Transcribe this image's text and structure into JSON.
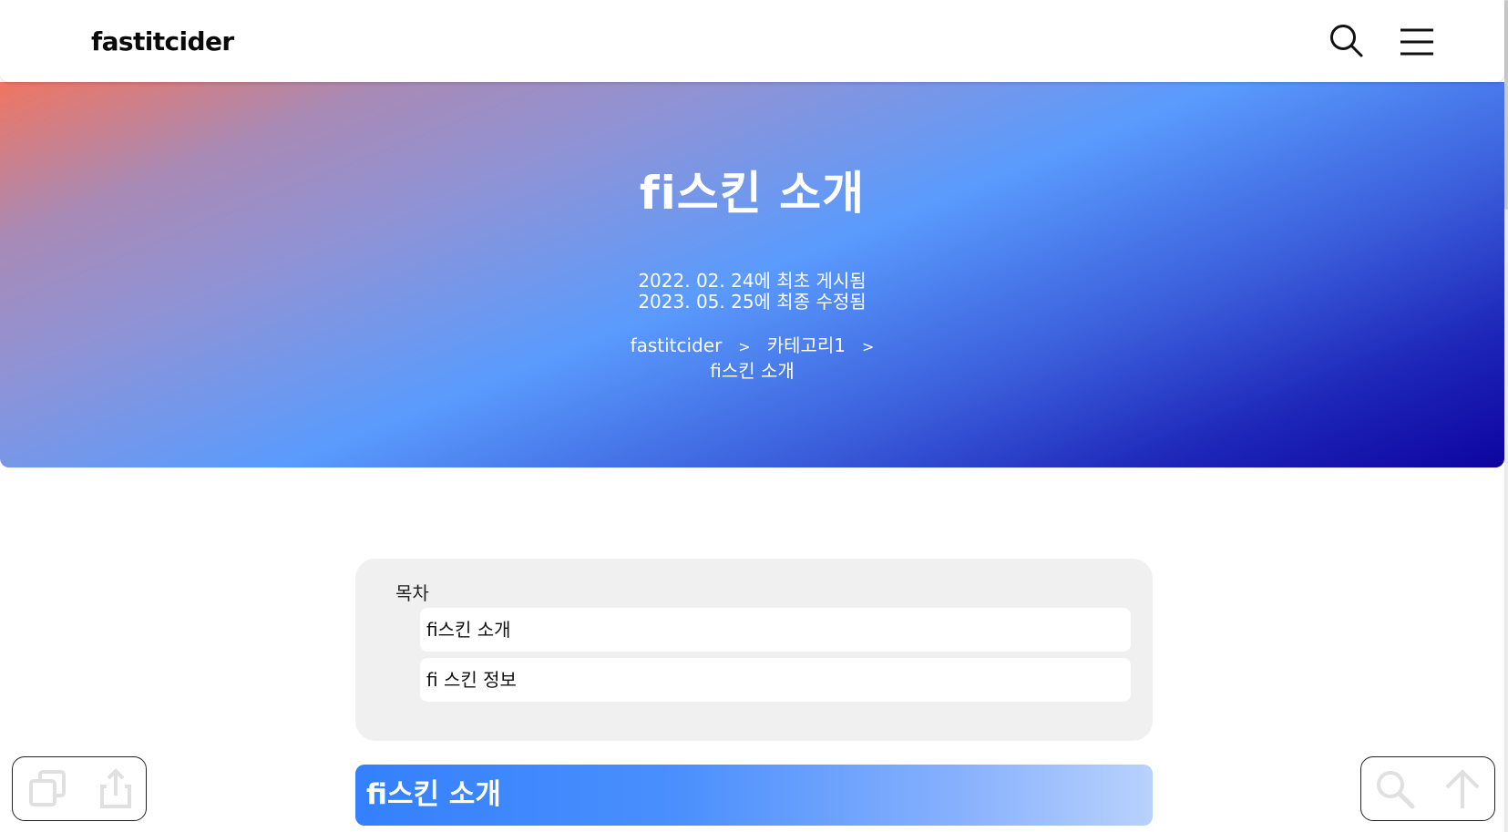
{
  "header": {
    "logo": "fastitcider",
    "search_icon": "search-icon",
    "menu_icon": "hamburger-menu-icon"
  },
  "hero": {
    "title": "fi스킨 소개",
    "posted": "2022. 02. 24에 최초 게시됨",
    "modified": "2023. 05. 25에 최종 수정됨",
    "breadcrumb": {
      "home": "fastitcider",
      "separator": ">",
      "category": "카테고리1",
      "current": "fi스킨 소개"
    },
    "gradient_colors": [
      "#f07560",
      "#5a9bfd",
      "#0e04a0"
    ]
  },
  "toc": {
    "title": "목차",
    "items": [
      {
        "label": "fi스킨 소개"
      },
      {
        "label": "fi 스킨 정보"
      }
    ]
  },
  "content": {
    "section_heading": "fi스킨 소개",
    "heading_colors": [
      "#3480fd",
      "#b9d2fd"
    ]
  },
  "floating_left": {
    "copy_icon": "copy-icon",
    "share_icon": "share-icon"
  },
  "floating_right": {
    "search_icon": "search-icon",
    "top_icon": "arrow-up-icon"
  }
}
